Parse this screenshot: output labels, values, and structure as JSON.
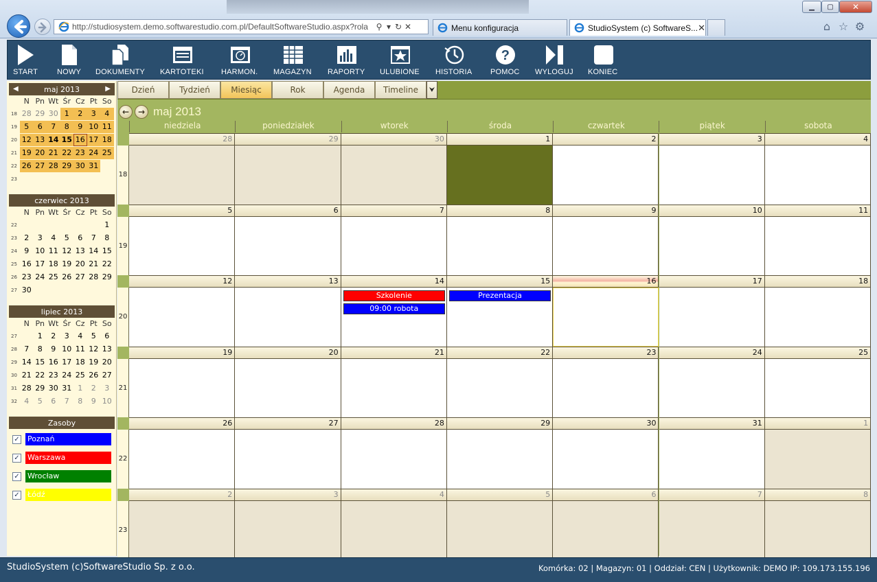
{
  "browser": {
    "address": "http://studiosystem.demo.softwarestudio.com.pl/DefaultSoftwareStudio.aspx?rola",
    "tabs": [
      {
        "label": "Menu konfiguracja"
      },
      {
        "label": "StudioSystem (c) SoftwareS..."
      }
    ],
    "close_glyph": "✕"
  },
  "toolbar": {
    "items": [
      {
        "label": "START",
        "icon": "play-icon"
      },
      {
        "label": "NOWY",
        "icon": "new-document-icon"
      },
      {
        "label": "DOKUMENTY",
        "icon": "documents-icon"
      },
      {
        "label": "KARTOTEKI",
        "icon": "window-icon"
      },
      {
        "label": "HARMON.",
        "icon": "clock-window-icon"
      },
      {
        "label": "MAGAZYN",
        "icon": "grid-icon"
      },
      {
        "label": "RAPORTY",
        "icon": "bar-chart-icon"
      },
      {
        "label": "ULUBIONE",
        "icon": "star-icon"
      },
      {
        "label": "HISTORIA",
        "icon": "history-icon"
      },
      {
        "label": "POMOC",
        "icon": "help-icon"
      },
      {
        "label": "WYLOGUJ",
        "icon": "logout-icon"
      },
      {
        "label": "KONIEC",
        "icon": "stop-icon"
      }
    ]
  },
  "mini_dow": [
    "N",
    "Pn",
    "Wt",
    "Śr",
    "Cz",
    "Pt",
    "So"
  ],
  "mini_calendars": [
    {
      "title": "maj 2013",
      "prev": "◀",
      "next": "▶",
      "weeks": [
        {
          "wn": "18",
          "days": [
            "28",
            "29",
            "30",
            "1",
            "2",
            "3",
            "4"
          ]
        },
        {
          "wn": "19",
          "days": [
            "5",
            "6",
            "7",
            "8",
            "9",
            "10",
            "11"
          ]
        },
        {
          "wn": "20",
          "days": [
            "12",
            "13",
            "14",
            "15",
            "16",
            "17",
            "18"
          ]
        },
        {
          "wn": "21",
          "days": [
            "19",
            "20",
            "21",
            "22",
            "23",
            "24",
            "25"
          ]
        },
        {
          "wn": "22",
          "days": [
            "26",
            "27",
            "28",
            "29",
            "30",
            "31",
            ""
          ]
        },
        {
          "wn": "23",
          "days": [
            "",
            "",
            "",
            "",
            "",
            "",
            ""
          ]
        }
      ]
    },
    {
      "title": "czerwiec 2013",
      "weeks": [
        {
          "wn": "22",
          "days": [
            "",
            "",
            "",
            "",
            "",
            "",
            "1"
          ]
        },
        {
          "wn": "23",
          "days": [
            "2",
            "3",
            "4",
            "5",
            "6",
            "7",
            "8"
          ]
        },
        {
          "wn": "24",
          "days": [
            "9",
            "10",
            "11",
            "12",
            "13",
            "14",
            "15"
          ]
        },
        {
          "wn": "25",
          "days": [
            "16",
            "17",
            "18",
            "19",
            "20",
            "21",
            "22"
          ]
        },
        {
          "wn": "26",
          "days": [
            "23",
            "24",
            "25",
            "26",
            "27",
            "28",
            "29"
          ]
        },
        {
          "wn": "27",
          "days": [
            "30",
            "",
            "",
            "",
            "",
            "",
            ""
          ]
        }
      ]
    },
    {
      "title": "lipiec 2013",
      "weeks": [
        {
          "wn": "27",
          "days": [
            "",
            "1",
            "2",
            "3",
            "4",
            "5",
            "6"
          ]
        },
        {
          "wn": "28",
          "days": [
            "7",
            "8",
            "9",
            "10",
            "11",
            "12",
            "13"
          ]
        },
        {
          "wn": "29",
          "days": [
            "14",
            "15",
            "16",
            "17",
            "18",
            "19",
            "20"
          ]
        },
        {
          "wn": "30",
          "days": [
            "21",
            "22",
            "23",
            "24",
            "25",
            "26",
            "27"
          ]
        },
        {
          "wn": "31",
          "days": [
            "28",
            "29",
            "30",
            "31",
            "1",
            "2",
            "3"
          ]
        },
        {
          "wn": "32",
          "days": [
            "4",
            "5",
            "6",
            "7",
            "8",
            "9",
            "10"
          ]
        }
      ]
    }
  ],
  "resources": {
    "title": "Zasoby",
    "check_glyph": "✓",
    "items": [
      {
        "label": "Poznań",
        "color": "#0000ff"
      },
      {
        "label": "Warszawa",
        "color": "#ff0000"
      },
      {
        "label": "Wrocław",
        "color": "#008000"
      },
      {
        "label": "Łódź",
        "color": "#ffff00"
      }
    ]
  },
  "calendar": {
    "view_tabs": [
      "Dzień",
      "Tydzień",
      "Miesiąc",
      "Rok",
      "Agenda",
      "Timeline"
    ],
    "active_tab": "Miesiąc",
    "more_glyph": "⮟",
    "title": "maj 2013",
    "dow": [
      "niedziela",
      "poniedziałek",
      "wtorek",
      "środa",
      "czwartek",
      "piątek",
      "sobota"
    ],
    "weeks": [
      {
        "wn": "18",
        "days": [
          "28",
          "29",
          "30",
          "1",
          "2",
          "3",
          "4"
        ]
      },
      {
        "wn": "19",
        "days": [
          "5",
          "6",
          "7",
          "8",
          "9",
          "10",
          "11"
        ]
      },
      {
        "wn": "20",
        "days": [
          "12",
          "13",
          "14",
          "15",
          "16",
          "17",
          "18"
        ]
      },
      {
        "wn": "21",
        "days": [
          "19",
          "20",
          "21",
          "22",
          "23",
          "24",
          "25"
        ]
      },
      {
        "wn": "22",
        "days": [
          "26",
          "27",
          "28",
          "29",
          "30",
          "31",
          "1"
        ]
      },
      {
        "wn": "23",
        "days": [
          "2",
          "3",
          "4",
          "5",
          "6",
          "7",
          "8"
        ]
      }
    ],
    "events": [
      {
        "label": "Szkolenie",
        "color": "#ff0000",
        "week": 2,
        "day": 2,
        "slot": 0
      },
      {
        "label": "09:00 robota",
        "color": "#0000ff",
        "week": 2,
        "day": 2,
        "slot": 1
      },
      {
        "label": "Prezentacja",
        "color": "#0000ff",
        "week": 2,
        "day": 3,
        "slot": 0
      }
    ]
  },
  "status": {
    "left": "StudioSystem (c)SoftwareStudio Sp. z o.o.",
    "right": "Komórka: 02 | Magazyn: 01 | Oddział: CEN | Użytkownik: DEMO IP: 109.173.155.196"
  }
}
